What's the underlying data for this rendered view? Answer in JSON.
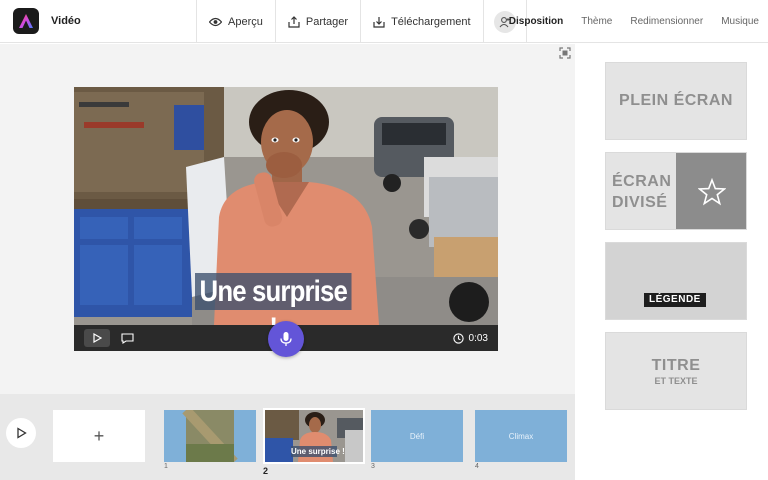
{
  "header": {
    "app_title": "Vidéo",
    "actions": [
      {
        "label": "Aperçu",
        "icon": "eye-icon"
      },
      {
        "label": "Partager",
        "icon": "share-icon"
      },
      {
        "label": "Téléchargement",
        "icon": "download-icon"
      }
    ],
    "user_icon": "user-icon",
    "tabs": [
      "Disposition",
      "Thème",
      "Redimensionner",
      "Musique"
    ],
    "active_tab": "Disposition"
  },
  "stage": {
    "caption": "Une surprise !",
    "time": "0:03"
  },
  "timeline": {
    "add_label": "+",
    "slides": [
      {
        "number": "1",
        "label": ""
      },
      {
        "number": "2",
        "label": "Une surprise !"
      },
      {
        "number": "3",
        "label": "Défi"
      },
      {
        "number": "4",
        "label": "Climax"
      }
    ]
  },
  "layouts": {
    "full_screen": "PLEIN ÉCRAN",
    "split_line1": "ÉCRAN",
    "split_line2": "DIVISÉ",
    "caption": "LÉGENDE",
    "title": "TITRE",
    "title_sub": "ET TEXTE"
  },
  "colors": {
    "accent": "#6355d8",
    "slide_blue": "#7fb0d8",
    "caption_bg": "#3c506e"
  }
}
